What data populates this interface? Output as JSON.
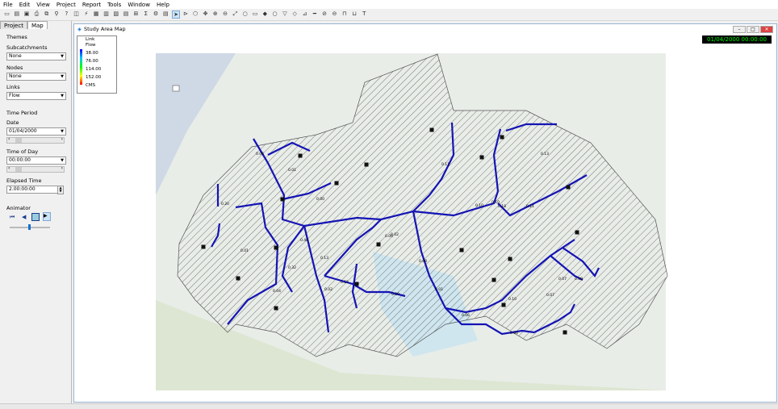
{
  "menu": [
    "File",
    "Edit",
    "View",
    "Project",
    "Report",
    "Tools",
    "Window",
    "Help"
  ],
  "toolbar_icons": [
    "new-icon",
    "open-icon",
    "save-icon",
    "print-icon",
    "copy-icon",
    "find-icon",
    "query-icon",
    "overview-icon",
    "run-icon",
    "profile-icon",
    "timeseries-icon",
    "scatter-icon",
    "table-icon",
    "statistics-icon",
    "summation-icon",
    "options-icon",
    "report-icon",
    "select-icon",
    "vertex-icon",
    "region-icon",
    "pan-icon",
    "zoomin-icon",
    "zoomout-icon",
    "fullextent-icon",
    "junction-icon",
    "subcatch-icon",
    "gage-icon",
    "junction2-icon",
    "outfall-icon",
    "divider-icon",
    "storage-icon",
    "conduit-icon",
    "pump-icon",
    "orifice-icon",
    "weir-icon",
    "outlet-icon",
    "label-icon"
  ],
  "left": {
    "tabs": [
      "Project",
      "Map"
    ],
    "themes": "Themes",
    "subcatchments_label": "Subcatchments",
    "subcatchments_value": "None",
    "nodes_label": "Nodes",
    "nodes_value": "None",
    "links_label": "Links",
    "links_value": "Flow",
    "time_period": "Time Period",
    "date_label": "Date",
    "date_value": "01/04/2000",
    "tod_label": "Time of Day",
    "tod_value": "00:00:00",
    "elapsed_label": "Elapsed Time",
    "elapsed_value": "2.00:00:00",
    "animator": "Animator"
  },
  "map": {
    "title": "Study Area Map",
    "clock": "01/04/2000 00:00:00",
    "legend_title": "Link",
    "legend_sub": "Flow",
    "legend_values": [
      "38.00",
      "76.00",
      "114.00",
      "152.00"
    ],
    "legend_unit": "CMS",
    "legend_colors": [
      "#0000ff",
      "#00c8ff",
      "#00ff00",
      "#ffff00",
      "#ff0000"
    ],
    "link_labels": [
      "0.06",
      "0.01",
      "0.00",
      "0.20",
      "0.01",
      "0.40",
      "0.13",
      "0.32",
      "0.15",
      "0.11",
      "0.10",
      "0.10",
      "0.08",
      "0.01",
      "0.28",
      "0.06",
      "0.04",
      "0.07",
      "0.10",
      "0.07",
      "0.09",
      "0.02",
      "0.04",
      "0.06",
      "0.18",
      "0.13",
      "0.11",
      "0.02"
    ]
  }
}
